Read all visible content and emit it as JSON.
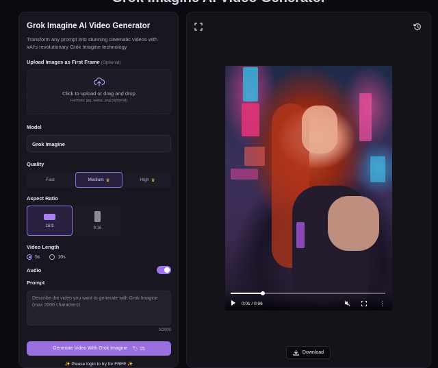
{
  "page": {
    "heading": "Grok Imagine AI Video Generator"
  },
  "generator": {
    "title": "Grok Imagine AI Video Generator",
    "description": "Transform any prompt into stunning cinematic videos with xAI's revolutionary Grok Imagine technology",
    "upload": {
      "label": "Upload Images as First Frame",
      "optional": "(Optional)",
      "dropzone_text": "Click to upload or drag and drop",
      "formats": "Formats: jpg, webp, png (optional)"
    },
    "model": {
      "label": "Model",
      "value": "Grok Imagine"
    },
    "quality": {
      "label": "Quality",
      "options": [
        "Fast",
        "Medium",
        "High"
      ],
      "selected": "Medium"
    },
    "aspect_ratio": {
      "label": "Aspect Ratio",
      "options": [
        "16:9",
        "9:16"
      ],
      "selected": "16:9"
    },
    "video_length": {
      "label": "Video Length",
      "options": [
        "5s",
        "10s"
      ],
      "selected": "5s"
    },
    "audio": {
      "label": "Audio",
      "enabled": true
    },
    "prompt": {
      "label": "Prompt",
      "placeholder": "Describe the video you want to generate with Grok Imagine (max 2000 characters)",
      "char_count": "0/2000"
    },
    "generate_button": {
      "label": "Generate Video With Grok Imagine",
      "credits": "15"
    },
    "login_note": "Please login to try for FREE"
  },
  "preview": {
    "video": {
      "time": "0:01 / 0:06",
      "progress": 0.21
    },
    "download_label": "Download"
  },
  "colors": {
    "accent": "#9870e0",
    "panel": "#18161f",
    "background": "#0c0b12",
    "crown": "#f3c64a"
  }
}
